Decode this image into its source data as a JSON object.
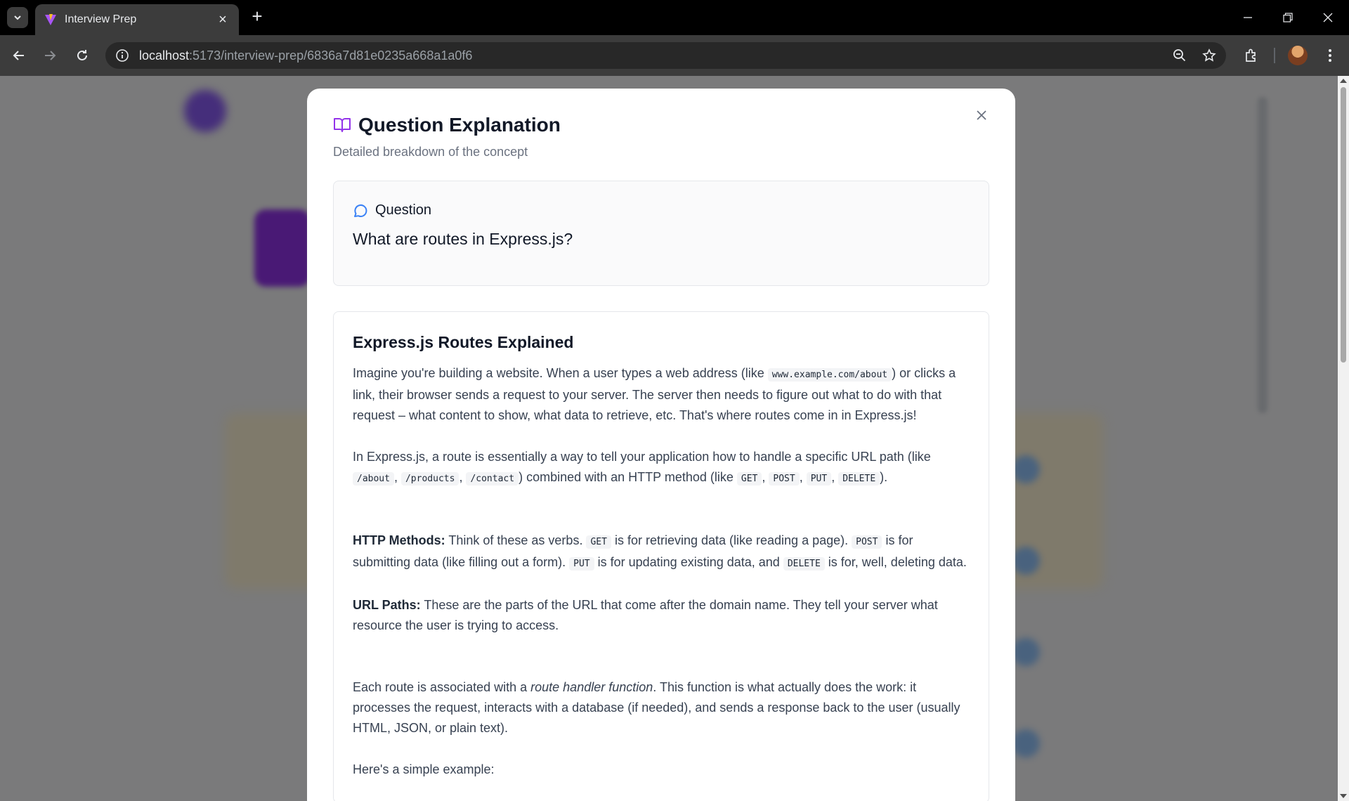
{
  "browser": {
    "tab_title": "Interview Prep",
    "url_host": "localhost",
    "url_path": ":5173/interview-prep/6836a7d81e0235a668a1a0f6"
  },
  "modal": {
    "title": "Question Explanation",
    "subtitle": "Detailed breakdown of the concept",
    "question_label": "Question",
    "question_text": "What are routes in Express.js?",
    "explanation_title": "Express.js Routes Explained",
    "p1": {
      "t1": "Imagine you're building a website. When a user types a web address (like ",
      "c1": "www.example.com/about",
      "t2": ") or clicks a link, their browser sends a request to your server. The server then needs to figure out what to do with that request – what content to show, what data to retrieve, etc. That's where routes come in in Express.js!"
    },
    "p2": {
      "t1": "In Express.js, a route is essentially a way to tell your application how to handle a specific URL path (like ",
      "c1": "/about",
      "c2": "/products",
      "c3": "/contact",
      "t2": ") combined with an HTTP method (like ",
      "c4": "GET",
      "c5": "POST",
      "c6": "PUT",
      "c7": "DELETE",
      "t3": ").",
      "comma": ", "
    },
    "p3": {
      "b1": "HTTP Methods:",
      "t1": " Think of these as verbs. ",
      "c1": "GET",
      "t2": " is for retrieving data (like reading a page). ",
      "c2": "POST",
      "t3": " is for submitting data (like filling out a form). ",
      "c3": "PUT",
      "t4": " is for updating existing data, and ",
      "c4": "DELETE",
      "t5": " is for, well, deleting data."
    },
    "p4": {
      "b1": "URL Paths:",
      "t1": " These are the parts of the URL that come after the domain name. They tell your server what resource the user is trying to access."
    },
    "p5": {
      "t1": "Each route is associated with a ",
      "i1": "route handler function",
      "t2": ". This function is what actually does the work: it processes the request, interacts with a database (if needed), and sends a response back to the user (usually HTML, JSON, or plain text)."
    },
    "p6": "Here's a simple example:"
  },
  "colors": {
    "accent": "#9333ea",
    "question_icon": "#3b82f6"
  },
  "icons": [
    "book-open-icon",
    "message-circle-icon",
    "close-icon"
  ]
}
